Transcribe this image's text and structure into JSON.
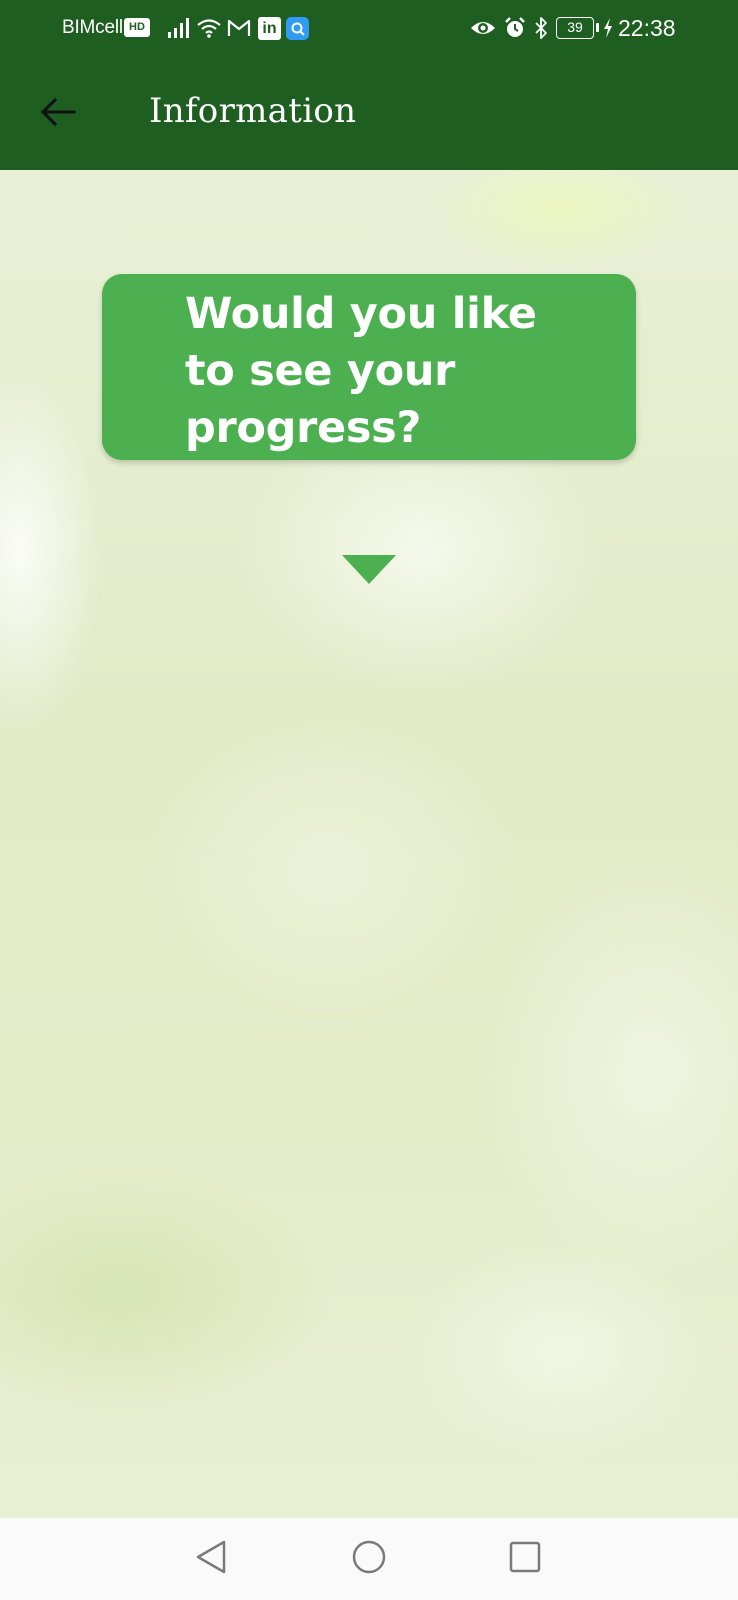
{
  "status_bar": {
    "carrier": "BIMcell",
    "hd_badge": "HD",
    "battery_level": "39",
    "time": "22:38",
    "icons": [
      "signal-icon",
      "wifi-icon",
      "gmail-icon",
      "linkedin-icon",
      "search-app-icon",
      "eye-icon",
      "alarm-icon",
      "bluetooth-icon",
      "battery-icon",
      "charging-icon"
    ]
  },
  "app_bar": {
    "title": "Information",
    "back_icon": "arrow-left-icon"
  },
  "main": {
    "question": "Would you like to see your progress?",
    "expand_icon": "triangle-down-icon"
  },
  "nav_bar": {
    "icons": [
      "back-triangle-icon",
      "home-circle-icon",
      "recents-square-icon"
    ]
  },
  "colors": {
    "primary_dark": "#1e5e20",
    "card_green": "#4caf50",
    "background": "#e3ecc9",
    "nav_bar": "#fafafa"
  }
}
